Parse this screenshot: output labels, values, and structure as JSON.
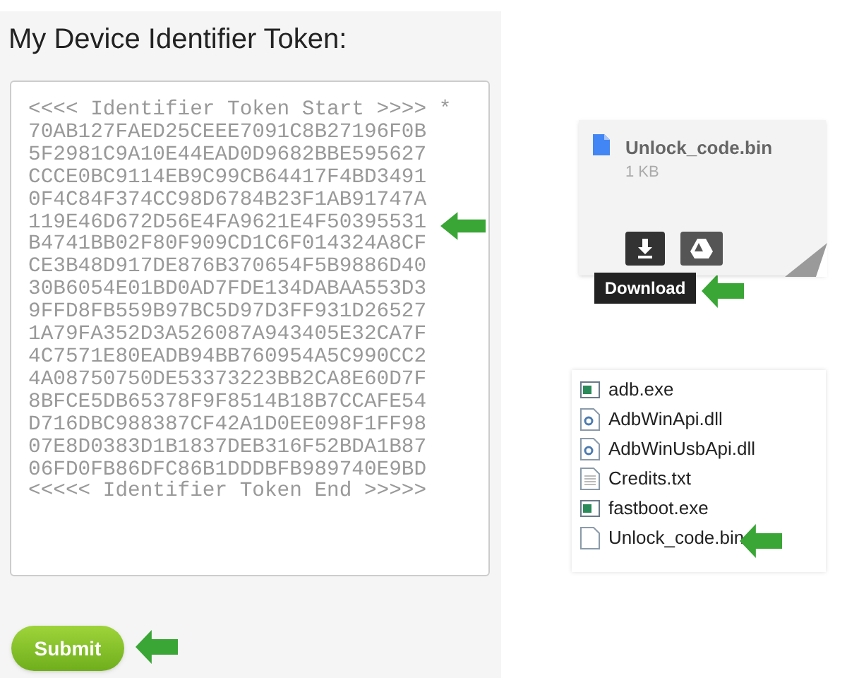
{
  "form": {
    "title": "My Device Identifier Token:",
    "token_lines": [
      "<<<< Identifier Token Start >>>> *",
      "70AB127FAED25CEEE7091C8B27196F0B",
      "5F2981C9A10E44EAD0D9682BBE595627",
      "CCCE0BC9114EB9C99CB64417F4BD3491",
      "0F4C84F374CC98D6784B23F1AB91747A",
      "119E46D672D56E4FA9621E4F50395531",
      "B4741BB02F80F909CD1C6F014324A8CF",
      "CE3B48D917DE876B370654F5B9886D40",
      "30B6054E01BD0AD7FDE134DABAA553D3",
      "9FFD8FB559B97BC5D97D3FF931D26527",
      "1A79FA352D3A526087A943405E32CA7F",
      "4C7571E80EADB94BB760954A5C990CC2",
      "4A08750750DE53373223BB2CA8E60D7F",
      "8BFCE5DB65378F9F8514B18B7CCAFE54",
      "D716DBC988387CF42A1D0EE098F1FF98",
      "07E8D0383D1B1837DEB316F52BDA1B87",
      "06FD0FB86DFC86B1DDDBFB989740E9BD",
      "<<<<< Identifier Token End >>>>>"
    ],
    "submit": "Submit"
  },
  "attachment": {
    "name": "Unlock_code.bin",
    "size": "1 KB",
    "tooltip": "Download"
  },
  "files": [
    {
      "name": "adb.exe",
      "kind": "exe"
    },
    {
      "name": "AdbWinApi.dll",
      "kind": "dll"
    },
    {
      "name": "AdbWinUsbApi.dll",
      "kind": "dll"
    },
    {
      "name": "Credits.txt",
      "kind": "txt"
    },
    {
      "name": "fastboot.exe",
      "kind": "exe"
    },
    {
      "name": "Unlock_code.bin",
      "kind": "bin"
    }
  ]
}
